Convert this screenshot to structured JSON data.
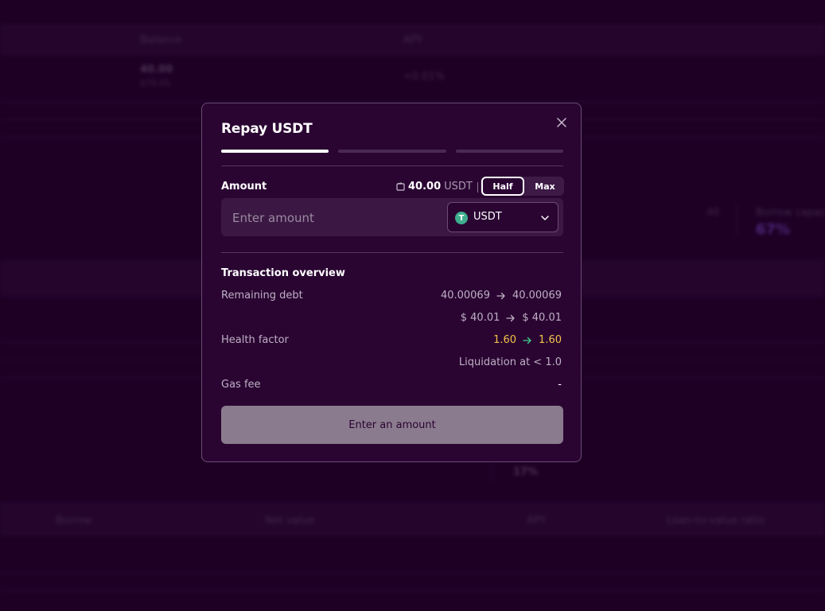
{
  "background": {
    "balance_header": "Balance",
    "apy_header": "APY",
    "balance_value": "40.00",
    "balance_sub": "$70.01",
    "apy_value": "<0.01%",
    "stat_value": "40",
    "borrow_capacity_label": "Borrow capacity",
    "borrow_capacity_value": "67%",
    "percent_value": "17%",
    "footer_headers": [
      "Borrow",
      "Net value",
      "APY",
      "Loan-to-value ratio"
    ]
  },
  "modal": {
    "title": "Repay USDT",
    "steps": [
      {
        "active": true
      },
      {
        "active": false
      },
      {
        "active": false
      }
    ],
    "amount_label": "Amount",
    "wallet_balance": "40.00",
    "wallet_unit": "USDT",
    "half_label": "Half",
    "max_label": "Max",
    "input_placeholder": "Enter amount",
    "token": {
      "symbol": "USDT",
      "icon_glyph": "T",
      "color": "#3fae8e"
    },
    "overview": {
      "title": "Transaction overview",
      "remaining_debt": {
        "label": "Remaining debt",
        "from": "40.00069",
        "to": "40.00069"
      },
      "remaining_debt_usd": {
        "from": "$ 40.01",
        "to": "$ 40.01"
      },
      "health_factor": {
        "label": "Health factor",
        "from": "1.60",
        "to": "1.60",
        "color": "#f5c24a"
      },
      "liquidation_note": "Liquidation at < 1.0",
      "gas_fee": {
        "label": "Gas fee",
        "value": "-"
      }
    },
    "submit_label": "Enter an amount"
  }
}
